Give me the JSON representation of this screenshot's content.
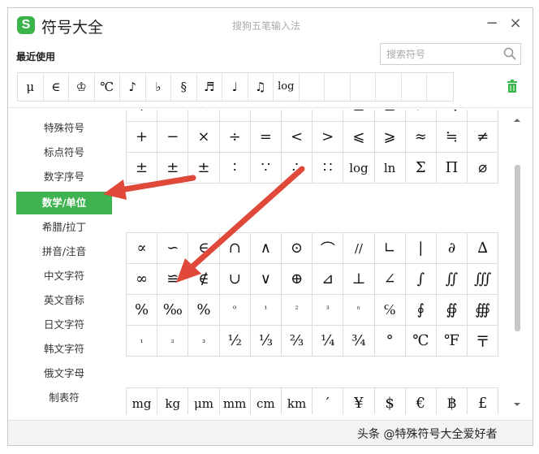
{
  "app": {
    "logo_letter": "S",
    "title": "符号大全",
    "ime_name": "搜狗五笔输入法",
    "minimize": "−",
    "close": "×"
  },
  "recent": {
    "label": "最近使用",
    "symbols": [
      "μ",
      "∈",
      "♔",
      "℃",
      "♪",
      "♭",
      "§",
      "♬",
      "♩",
      "♫",
      "log",
      "",
      "",
      "",
      "",
      "",
      ""
    ]
  },
  "search": {
    "placeholder": "搜索符号"
  },
  "sidebar": {
    "items": [
      {
        "label": "特殊符号"
      },
      {
        "label": "标点符号"
      },
      {
        "label": "数字序号"
      },
      {
        "label": "数学/单位"
      },
      {
        "label": "希腊/拉丁"
      },
      {
        "label": "拼音/注音"
      },
      {
        "label": "中文字符"
      },
      {
        "label": "英文音标"
      },
      {
        "label": "日文字符"
      },
      {
        "label": "韩文字符"
      },
      {
        "label": "俄文字母"
      },
      {
        "label": "制表符"
      }
    ],
    "active_index": 3,
    "active_color": "#3fb34f"
  },
  "grid_top": {
    "rows": [
      [
        "+",
        "−",
        "×",
        "÷",
        "=",
        "<",
        ">",
        "≤",
        "≥",
        "≠",
        "≒",
        "≈"
      ],
      [
        "+",
        "−",
        "×",
        "÷",
        "=",
        "<",
        ">",
        "⩽",
        "⩾",
        "≈",
        "≒",
        "≠"
      ],
      [
        "±",
        "±",
        "±",
        "∶",
        "∵",
        "∴",
        "∷",
        "log",
        "ln",
        "Σ",
        "Π",
        "⌀"
      ]
    ]
  },
  "grid_mid": {
    "rows": [
      [
        "∝",
        "∽",
        "∈",
        "∩",
        "∧",
        "⊙",
        "⌒",
        "//",
        "∟",
        "|",
        "∂",
        "∆"
      ],
      [
        "∞",
        "≌",
        "∉",
        "∪",
        "∨",
        "⊕",
        "⊿",
        "⊥",
        "∠",
        "∫",
        "∬",
        "∭"
      ],
      [
        "%",
        "‰",
        "%",
        "⁰",
        "¹",
        "²",
        "³",
        "ⁿ",
        "℅",
        "∮",
        "∯",
        "∰"
      ],
      [
        "₁",
        "₂",
        "₃",
        "½",
        "⅓",
        "⅔",
        "¼",
        "¾",
        "°",
        "℃",
        "℉",
        "〒"
      ]
    ]
  },
  "grid_units": {
    "rows": [
      [
        "mg",
        "kg",
        "μm",
        "mm",
        "cm",
        "km",
        "′",
        "¥",
        "$",
        "€",
        "฿",
        "£"
      ]
    ]
  },
  "watermark": "头条 @特殊符号大全爱好者",
  "colors": {
    "accent": "#3fb34f",
    "arrow": "#e0483a"
  }
}
